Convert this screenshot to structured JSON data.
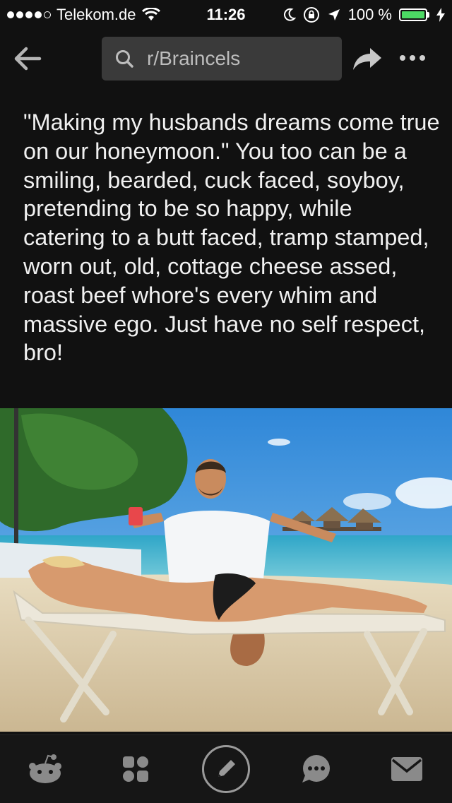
{
  "status_bar": {
    "carrier": "Telekom.de",
    "time": "11:26",
    "battery_percent": "100 %",
    "battery_level": 1.0
  },
  "nav": {
    "search_text": "r/Braincels",
    "icons": [
      "back-arrow-icon",
      "search-icon",
      "share-icon",
      "more-icon"
    ]
  },
  "post": {
    "title": "\"Making my husbands dreams come true on our honeymoon.\" You too can be a smiling, bearded, cuck faced, soyboy, pretending to be so happy, while catering to a butt faced, tramp stamped, worn out, old, cottage cheese assed, roast beef whore's every whim and massive ego. Just have no self respect, bro!"
  },
  "tab_bar": {
    "icons": [
      "home-snoo-icon",
      "communities-icon",
      "compose-icon",
      "chat-icon",
      "inbox-icon"
    ]
  },
  "colors": {
    "background": "#111111",
    "search_box": "#3a3a3a",
    "icon_gray": "#9a9a9a",
    "battery_green": "#4cd964"
  }
}
